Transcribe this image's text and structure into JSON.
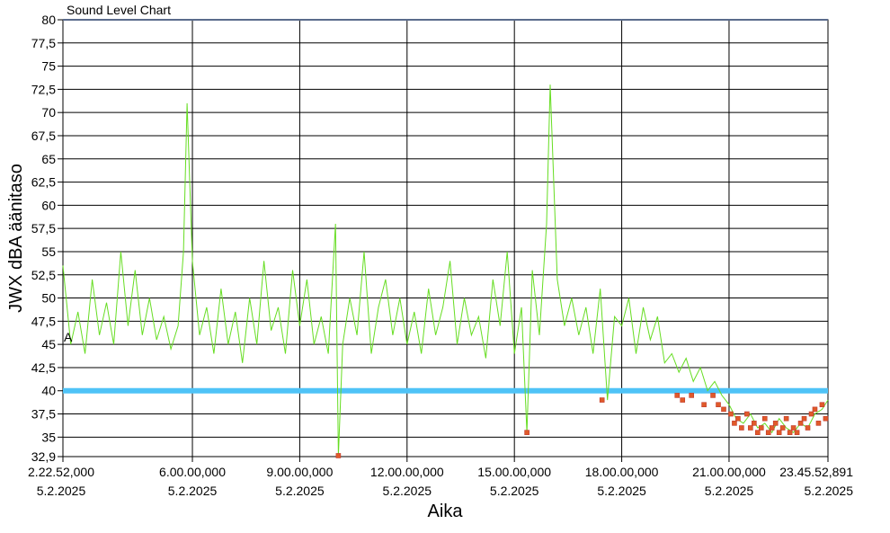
{
  "chart_data": {
    "type": "line",
    "title": "Sound Level Chart",
    "xlabel": "Aika",
    "ylabel": "JWX dBA äänitaso",
    "ylim": [
      32.9,
      80
    ],
    "y_ticks": [
      32.9,
      35,
      37.5,
      40,
      42.5,
      45,
      47.5,
      50,
      52.5,
      55,
      57.5,
      60,
      62.5,
      65,
      67.5,
      70,
      72.5,
      75,
      77.5,
      80
    ],
    "y_tick_labels": [
      "32,9",
      "35",
      "37,5",
      "40",
      "42,5",
      "45",
      "47,5",
      "50",
      "52,5",
      "55",
      "57,5",
      "60",
      "62,5",
      "65",
      "67,5",
      "70",
      "72,5",
      "75",
      "77,5",
      "80"
    ],
    "x_range_hours": [
      2.381,
      23.765
    ],
    "x_ticks_hours": [
      2.381,
      6,
      9,
      12,
      15,
      18,
      21,
      23.765
    ],
    "x_tick_labels": [
      {
        "time": "2.22.52,000",
        "date": "5.2.2025"
      },
      {
        "time": "6.00.00,000",
        "date": "5.2.2025"
      },
      {
        "time": "9.00.00,000",
        "date": "5.2.2025"
      },
      {
        "time": "12.00.00,000",
        "date": "5.2.2025"
      },
      {
        "time": "15.00.00,000",
        "date": "5.2.2025"
      },
      {
        "time": "18.00.00,000",
        "date": "5.2.2025"
      },
      {
        "time": "21.00.00,000",
        "date": "5.2.2025"
      },
      {
        "time": "23.45.52,891",
        "date": "5.2.2025"
      }
    ],
    "threshold": {
      "value": 40,
      "color": "#4FC3F7"
    },
    "grid": true,
    "marker_label": "A",
    "colors": {
      "line": "#66DD22",
      "markers": "#E05A2A",
      "marker_edge": "#C0392B"
    },
    "series": [
      {
        "x_hours": [
          2.381,
          2.6,
          2.8,
          3.0,
          3.2,
          3.4,
          3.6,
          3.8,
          4.0,
          4.2,
          4.4,
          4.6,
          4.8,
          5.0,
          5.2,
          5.4,
          5.6,
          5.75,
          5.85,
          6.0,
          6.2,
          6.4,
          6.6,
          6.8,
          7.0,
          7.2,
          7.4,
          7.6,
          7.8,
          8.0,
          8.2,
          8.4,
          8.6,
          8.8,
          9.0,
          9.2,
          9.4,
          9.6,
          9.8,
          10.0,
          10.08,
          10.2,
          10.4,
          10.6,
          10.8,
          11.0,
          11.2,
          11.4,
          11.6,
          11.8,
          12.0,
          12.2,
          12.4,
          12.6,
          12.8,
          13.0,
          13.2,
          13.4,
          13.6,
          13.8,
          14.0,
          14.2,
          14.4,
          14.6,
          14.8,
          15.0,
          15.2,
          15.35,
          15.5,
          15.7,
          15.9,
          16.0,
          16.2,
          16.4,
          16.6,
          16.8,
          17.0,
          17.2,
          17.4,
          17.6,
          17.8,
          18.0,
          18.2,
          18.4,
          18.6,
          18.8,
          19.0,
          19.2,
          19.4,
          19.6,
          19.8,
          20.0,
          20.2,
          20.4,
          20.6,
          20.8,
          21.0,
          21.2,
          21.4,
          21.6,
          21.8,
          22.0,
          22.2,
          22.4,
          22.6,
          22.8,
          23.0,
          23.2,
          23.4,
          23.6,
          23.765
        ],
        "values": [
          53.5,
          45,
          48.5,
          44,
          52,
          46,
          49.5,
          45,
          55,
          47,
          53,
          46,
          50,
          45.5,
          48,
          44.5,
          47,
          55,
          71,
          54,
          46,
          49,
          44,
          51,
          45,
          48.5,
          43,
          50,
          45,
          54,
          46.5,
          49,
          44,
          53,
          47,
          52,
          45,
          48,
          44,
          58,
          33,
          45,
          50,
          46,
          55,
          44,
          49,
          52,
          46,
          50,
          45,
          48.5,
          44,
          51,
          46,
          49,
          54,
          45,
          50,
          46,
          48,
          43.5,
          52,
          47,
          55,
          44,
          49,
          35.5,
          53,
          46,
          58,
          73,
          52,
          47,
          50,
          46,
          49,
          44,
          51,
          39,
          48,
          47,
          50,
          44,
          49,
          45.5,
          48,
          43,
          44,
          42,
          43.5,
          41,
          42.5,
          40,
          41,
          39.5,
          38.5,
          37,
          36.5,
          37.5,
          36,
          36.5,
          35.5,
          37,
          36,
          35.5,
          36.5,
          36,
          37.5,
          38,
          39
        ]
      },
      {
        "name": "",
        "type": "scatter",
        "x_hours": [
          10.08,
          15.35,
          17.45,
          19.55,
          19.7,
          19.95,
          20.3,
          20.55,
          20.7,
          20.85,
          21.05,
          21.15,
          21.25,
          21.35,
          21.5,
          21.6,
          21.7,
          21.8,
          21.9,
          22.0,
          22.1,
          22.2,
          22.3,
          22.4,
          22.5,
          22.6,
          22.7,
          22.8,
          22.9,
          23.0,
          23.1,
          23.2,
          23.3,
          23.4,
          23.5,
          23.6,
          23.7
        ],
        "values": [
          33,
          35.5,
          39,
          39.5,
          39,
          39.5,
          38.5,
          39.5,
          38.5,
          38,
          37.5,
          36.5,
          37,
          36,
          37.5,
          36,
          36.5,
          35.5,
          36,
          37,
          35.5,
          36,
          36.5,
          35.5,
          36,
          37,
          35.5,
          36,
          35.5,
          36.5,
          37,
          36,
          37.5,
          38,
          36.5,
          38.5,
          37
        ]
      }
    ]
  }
}
